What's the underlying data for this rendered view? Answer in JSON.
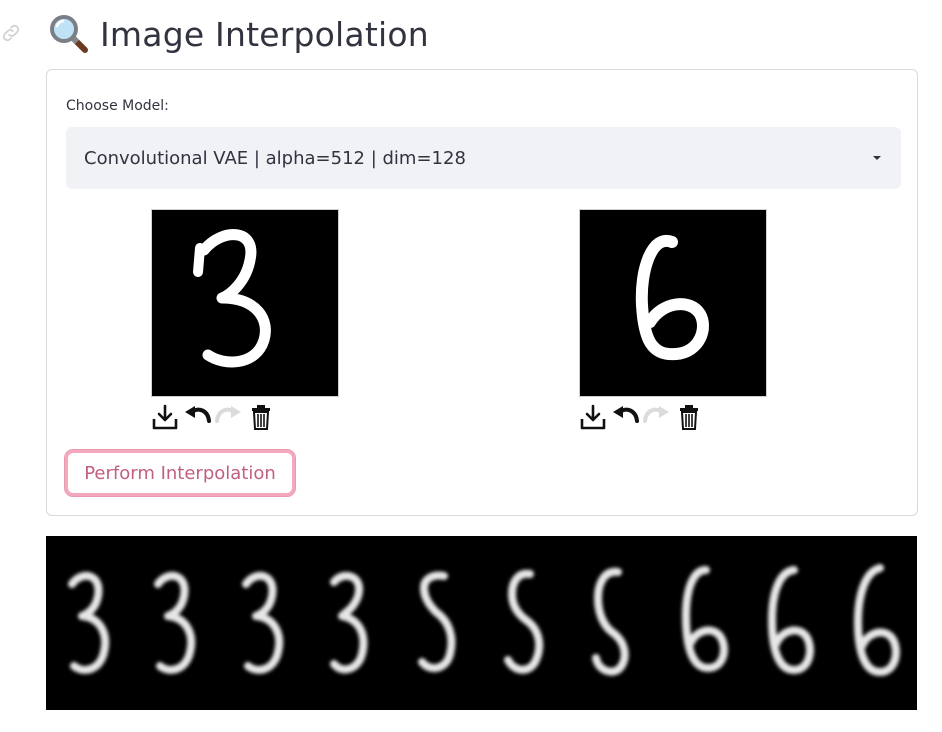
{
  "page": {
    "title": "Image Interpolation",
    "title_icon": "magnifying-glass-icon",
    "anchor_icon": "link-icon"
  },
  "form": {
    "select_label": "Choose Model:",
    "selected_model": "Convolutional VAE | alpha=512 | dim=128",
    "canvases": [
      {
        "drawn_digit": "3",
        "tools": [
          "download-icon",
          "undo-icon",
          "redo-icon",
          "trash-icon"
        ]
      },
      {
        "drawn_digit": "6",
        "tools": [
          "download-icon",
          "undo-icon",
          "redo-icon",
          "trash-icon"
        ]
      }
    ],
    "submit_label": "Perform Interpolation",
    "accent_color": "#f4a7bd"
  },
  "result": {
    "frames": [
      "3",
      "3",
      "3",
      "3",
      "5",
      "5",
      "5",
      "6",
      "6",
      "6"
    ]
  }
}
